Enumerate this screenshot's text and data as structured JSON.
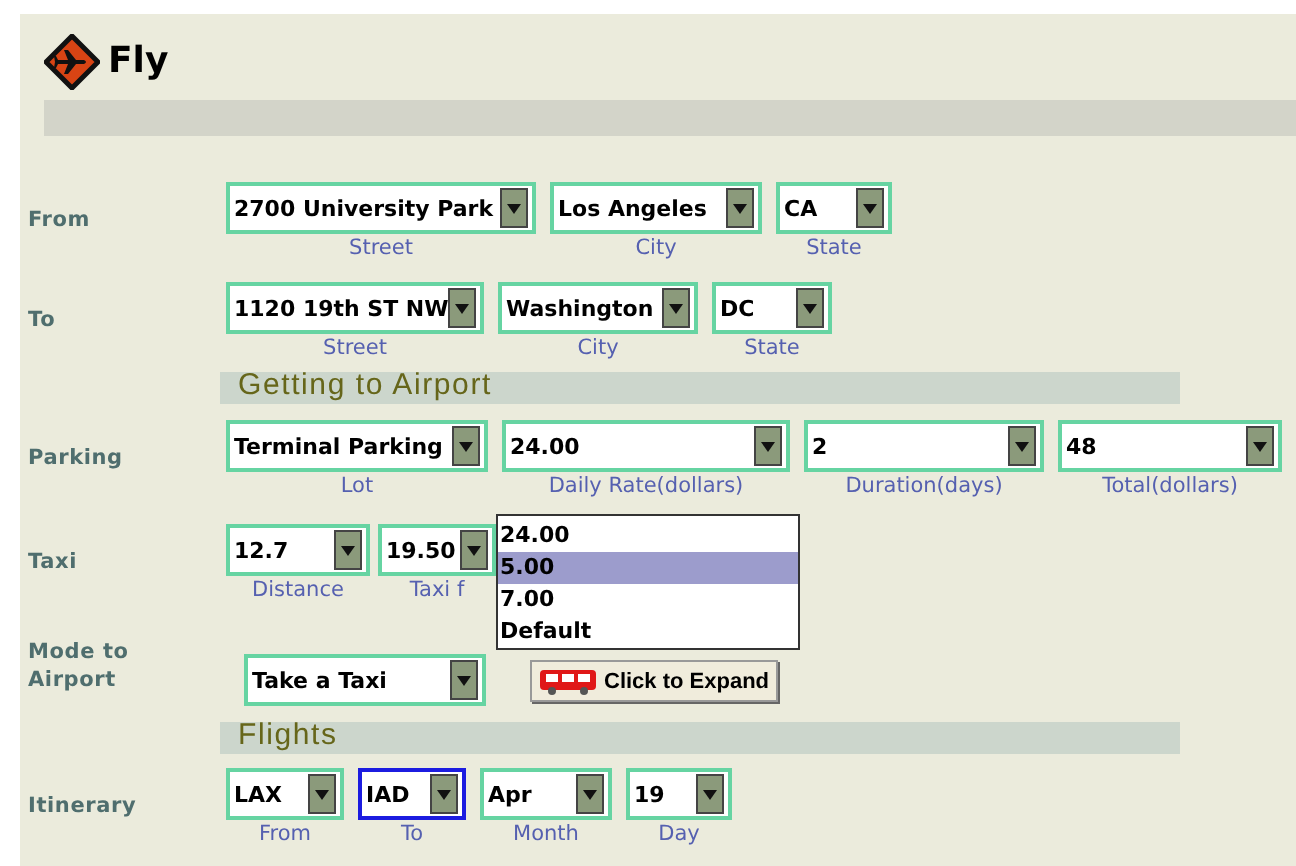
{
  "header": {
    "title": "Fly"
  },
  "form": [
    {
      "kind": "row",
      "label": "From",
      "fields": [
        {
          "value": "2700 University Park",
          "caption": "Street"
        },
        {
          "value": "Los Angeles",
          "caption": "City"
        },
        {
          "value": "CA",
          "caption": "State"
        }
      ]
    },
    {
      "kind": "row",
      "label": "To",
      "fields": [
        {
          "value": "1120 19th ST NW",
          "caption": "Street"
        },
        {
          "value": "Washington",
          "caption": "City"
        },
        {
          "value": "DC",
          "caption": "State"
        }
      ]
    },
    {
      "kind": "section",
      "title": "Getting to Airport"
    },
    {
      "kind": "row",
      "label": "Parking",
      "fields": [
        {
          "value": "Terminal Parking",
          "caption": "Lot"
        },
        {
          "value": "24.00",
          "caption": "Daily Rate(dollars)"
        },
        {
          "value": "2",
          "caption": "Duration(days)"
        },
        {
          "value": "48",
          "caption": "Total(dollars)"
        }
      ]
    },
    {
      "kind": "row",
      "label": "Taxi",
      "fields": [
        {
          "value": "12.7",
          "caption": "Distance"
        },
        {
          "value": "19.50",
          "caption": "Taxi f"
        }
      ]
    },
    {
      "kind": "row",
      "label": "Mode to Airport",
      "fields": [
        {
          "value": "Take a Taxi"
        }
      ],
      "button": "Click to Expand"
    },
    {
      "kind": "section",
      "title": "Flights"
    },
    {
      "kind": "row",
      "label": "Itinerary",
      "fields": [
        {
          "value": "LAX",
          "caption": "From",
          "focused": false
        },
        {
          "value": "IAD",
          "caption": "To",
          "focused": true
        },
        {
          "value": "Apr",
          "caption": "Month",
          "focused": false
        },
        {
          "value": "19",
          "caption": "Day",
          "focused": false
        }
      ]
    }
  ],
  "open_dropdown": {
    "options": [
      {
        "label": "24.00",
        "selected": false
      },
      {
        "label": "5.00",
        "selected": true
      },
      {
        "label": "7.00",
        "selected": false
      },
      {
        "label": "Default",
        "selected": false
      }
    ]
  }
}
